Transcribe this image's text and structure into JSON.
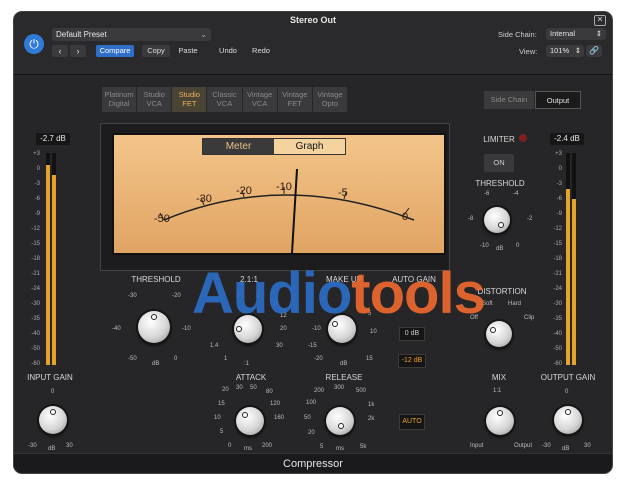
{
  "window": {
    "title": "Stereo Out",
    "footer": "Compressor"
  },
  "toolbar": {
    "preset": "Default Preset",
    "compare": "Compare",
    "copy": "Copy",
    "paste": "Paste",
    "undo": "Undo",
    "redo": "Redo",
    "side_chain_label": "Side Chain:",
    "side_chain_value": "Internal",
    "view_label": "View:",
    "view_value": "101%"
  },
  "models": [
    {
      "line1": "Platinum",
      "line2": "Digital"
    },
    {
      "line1": "Studio",
      "line2": "VCA"
    },
    {
      "line1": "Studio",
      "line2": "FET"
    },
    {
      "line1": "Classic",
      "line2": "VCA"
    },
    {
      "line1": "Vintage",
      "line2": "VCA"
    },
    {
      "line1": "Vintage",
      "line2": "FET"
    },
    {
      "line1": "Vintage",
      "line2": "Opto"
    }
  ],
  "selected_model": "Studio FET",
  "sidechain_output": {
    "side_chain": "Side Chain",
    "output": "Output"
  },
  "input": {
    "readout": "-2.7 dB",
    "label": "INPUT GAIN",
    "ticks": [
      "-30",
      "0",
      "30"
    ],
    "unit": "dB"
  },
  "output": {
    "readout": "-2.4 dB",
    "label": "OUTPUT GAIN",
    "ticks": [
      "-30",
      "0",
      "30"
    ],
    "unit": "dB"
  },
  "meter_scale": [
    "+3",
    "0",
    "-3",
    "-6",
    "-9",
    "-12",
    "-15",
    "-18",
    "-21",
    "-24",
    "-30",
    "-35",
    "-40",
    "-50",
    "-60"
  ],
  "vu": {
    "meter_tab": "Meter",
    "graph_tab": "Graph",
    "scale": [
      "-50",
      "-30",
      "-20",
      "-10",
      "-5",
      "0"
    ]
  },
  "limiter": {
    "label": "LIMITER",
    "on": "ON",
    "threshold_label": "THRESHOLD",
    "ticks": [
      "-6",
      "-4",
      "-8",
      "-2",
      "-10",
      "0"
    ],
    "unit": "dB"
  },
  "threshold": {
    "label": "THRESHOLD",
    "ticks": [
      "-30",
      "-20",
      "-40",
      "-10",
      "-50",
      "0"
    ],
    "unit": "dB"
  },
  "ratio": {
    "label": "2.1:1",
    "ticks": [
      "3",
      "5",
      "8",
      "12",
      "20",
      "30",
      "1.4",
      "1"
    ],
    "unit": ":1"
  },
  "makeup": {
    "label": "MAKE UP",
    "ticks": [
      "-10",
      "0",
      "-15",
      "5",
      "-20",
      "10",
      "15"
    ],
    "unit": "dB"
  },
  "auto_gain": {
    "label": "AUTO GAIN",
    "off": "0 dB",
    "value": "-12 dB"
  },
  "distortion": {
    "label": "DISTORTION",
    "soft": "Soft",
    "hard": "Hard",
    "off": "Off",
    "clip": "Clip"
  },
  "attack": {
    "label": "ATTACK",
    "ticks": [
      "20",
      "30",
      "50",
      "80",
      "15",
      "120",
      "10",
      "160",
      "5",
      "200",
      "0"
    ],
    "unit": "ms"
  },
  "release": {
    "label": "RELEASE",
    "ticks": [
      "200",
      "300",
      "500",
      "100",
      "1k",
      "50",
      "2k",
      "20",
      "5k",
      "5"
    ],
    "unit": "ms"
  },
  "auto_button": "AUTO",
  "mix": {
    "label": "MIX",
    "ratio": "1:1",
    "left": "Input",
    "right": "Output"
  },
  "watermark": {
    "part1": "Audio",
    "part2": "tools"
  }
}
